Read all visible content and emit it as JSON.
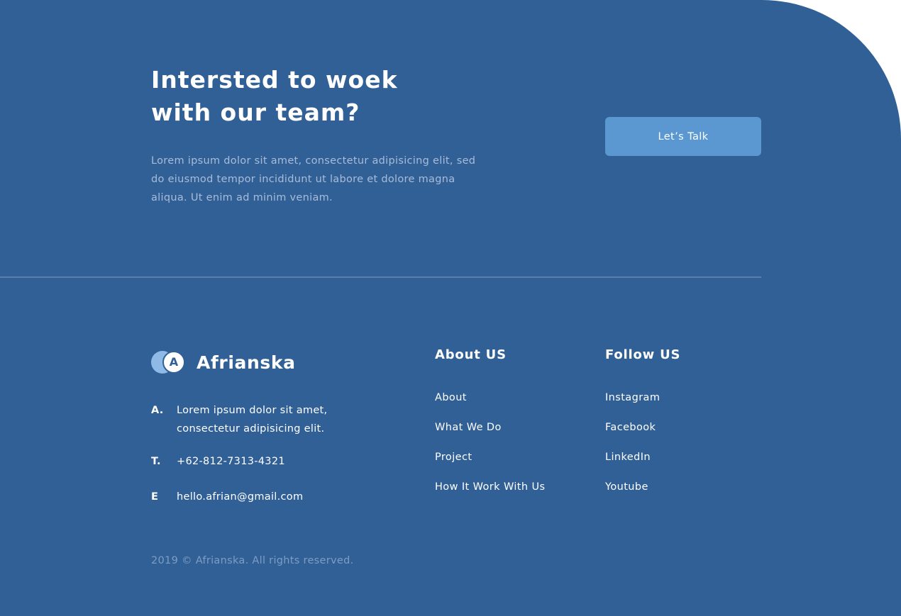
{
  "cta": {
    "title": "Intersted to woek with our team?",
    "description": "Lorem ipsum dolor sit amet, consectetur adipisicing elit, sed do eiusmod tempor incididunt ut labore et dolore magna aliqua. Ut enim ad minim veniam.",
    "button_label": "Let’s Talk"
  },
  "brand": {
    "logo_letter": "A",
    "name": "Afrianska"
  },
  "contact": {
    "address_key": "A.",
    "address_value": "Lorem ipsum dolor sit amet, consectetur adipisicing elit.",
    "phone_key": "T.",
    "phone_value": "+62-812-7313-4321",
    "email_key": "E",
    "email_value": "hello.afrian@gmail.com"
  },
  "about": {
    "heading": "About US",
    "links": [
      "About",
      "What We Do",
      "Project",
      "How It Work With Us"
    ]
  },
  "follow": {
    "heading": "Follow US",
    "links": [
      "Instagram",
      "Facebook",
      "LinkedIn",
      "Youtube"
    ]
  },
  "footer": {
    "copyright": "2019 © Afrianska. All rights reserved."
  },
  "colors": {
    "background": "#316097",
    "button": "#5b98d1",
    "muted_text": "#a8bcd8",
    "logo_accent": "#8fb9e6"
  },
  "icons": {
    "logo": "brand-logo-icon"
  }
}
